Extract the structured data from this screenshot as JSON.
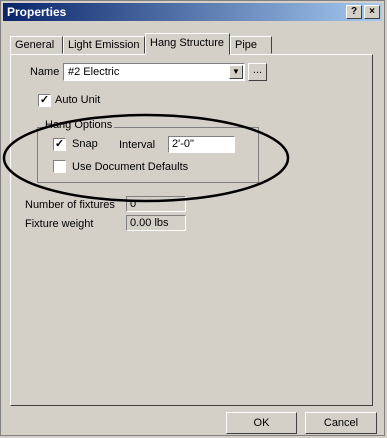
{
  "window": {
    "title": "Properties",
    "help_label": "?",
    "close_label": "×"
  },
  "tabs": [
    {
      "label": "General"
    },
    {
      "label": "Light Emission"
    },
    {
      "label": "Hang Structure"
    },
    {
      "label": "Pipe"
    }
  ],
  "name": {
    "label": "Name",
    "value": "#2 Electric",
    "browse_label": "..."
  },
  "auto_unit": {
    "label": "Auto Unit",
    "checked": true
  },
  "hang_options": {
    "title": "Hang Options",
    "snap": {
      "label": "Snap",
      "checked": true
    },
    "interval": {
      "label": "Interval",
      "value": "2'-0\""
    },
    "use_document_defaults": {
      "label": "Use Document Defaults",
      "checked": false
    }
  },
  "stats": {
    "fixtures_label": "Number of fixtures",
    "fixtures_value": "0",
    "weight_label": "Fixture weight",
    "weight_value": "0.00 lbs"
  },
  "buttons": {
    "ok": "OK",
    "cancel": "Cancel"
  },
  "annotation": {
    "shape": "ellipse",
    "color": "#000000"
  }
}
